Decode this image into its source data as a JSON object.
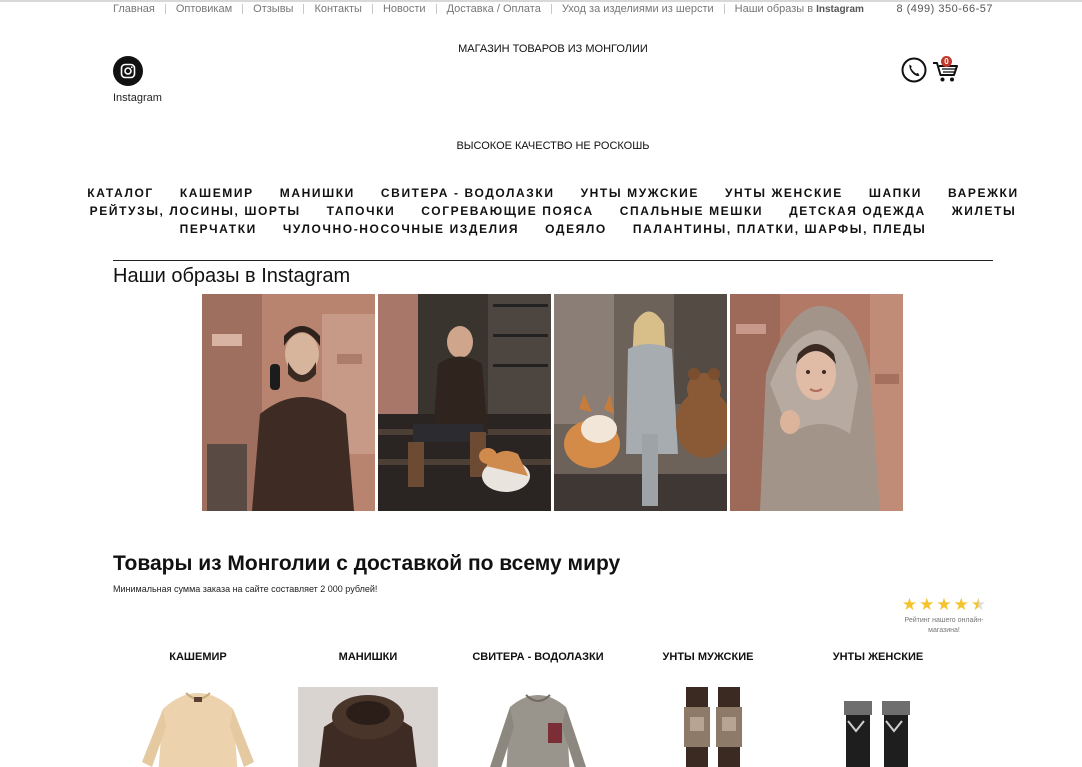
{
  "top_nav": {
    "items": [
      "Главная",
      "Оптовикам",
      "Отзывы",
      "Контакты",
      "Новости",
      "Доставка / Оплата",
      "Уход за изделиями из шерсти",
      "Наши образы в"
    ],
    "instagram_word": "Instagram",
    "phone": "8 (499) 350-66-57"
  },
  "header": {
    "instagram_label": "Instagram",
    "tagline_top": "МАГАЗИН ТОВАРОВ ИЗ МОНГОЛИИ",
    "tagline_bottom": "ВЫСОКОЕ КАЧЕСТВО НЕ РОСКОШЬ",
    "cart_count": "0",
    "icons": [
      "instagram-icon",
      "phone-icon",
      "cart-icon"
    ]
  },
  "main_menu": {
    "rows": [
      [
        "КАТАЛОГ",
        "КАШЕМИР",
        "МАНИШКИ",
        "СВИТЕРА - ВОДОЛАЗКИ",
        "УНТЫ МУЖСКИЕ",
        "УНТЫ ЖЕНСКИЕ",
        "ШАПКИ",
        "ВАРЕЖКИ"
      ],
      [
        "РЕЙТУЗЫ, ЛОСИНЫ, ШОРТЫ",
        "ТАПОЧКИ",
        "СОГРЕВАЮЩИЕ ПОЯСА",
        "СПАЛЬНЫЕ МЕШКИ",
        "ДЕТСКАЯ ОДЕЖДА",
        "ЖИЛЕТЫ"
      ],
      [
        "ПЕРЧАТКИ",
        "ЧУЛОЧНО-НОСОЧНЫЕ ИЗДЕЛИЯ",
        "ОДЕЯЛО",
        "ПАЛАНТИНЫ, ПЛАТКИ, ШАРФЫ, ПЛЕДЫ"
      ]
    ]
  },
  "instagram_section": {
    "heading": "Наши образы в Instagram"
  },
  "goods_section": {
    "heading": "Товары из Монголии с доставкой по всему миру",
    "subtext": "Минимальная сумма заказа на сайте составляет 2 000 рублей!",
    "rating": {
      "filled_stars": 4,
      "half_star": true,
      "total_stars": 5,
      "label": "Рейтинг нашего онлайн-магазина!"
    },
    "categories": [
      "КАШЕМИР",
      "МАНИШКИ",
      "СВИТЕРА - ВОДОЛАЗКИ",
      "УНТЫ МУЖСКИЕ",
      "УНТЫ ЖЕНСКИЕ"
    ]
  },
  "colors": {
    "text": "#111111",
    "muted": "#777777",
    "star": "#f4c430",
    "badge": "#c0392b"
  }
}
